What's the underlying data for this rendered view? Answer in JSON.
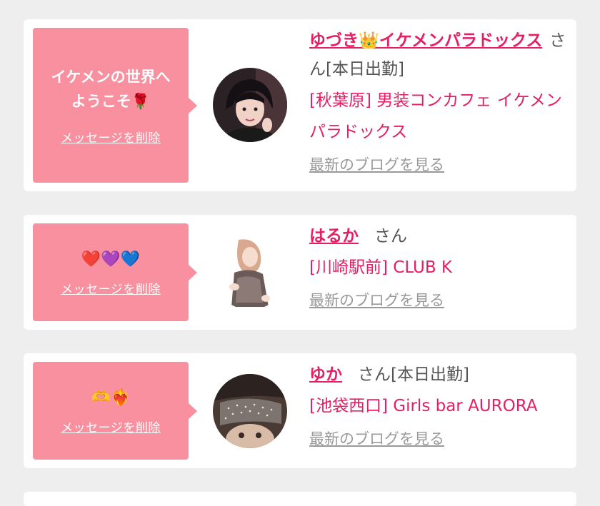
{
  "cards": [
    {
      "message": "イケメンの世界へ\nようこそ🌹",
      "delete_label": "メッセージを削除",
      "name": "ゆづき👑イケメンパラドックス",
      "san": "さん[本日出勤]",
      "shop": "[秋葉原] 男装コンカフェ イケメンパラドックス",
      "blog_label": "最新のブログを見る",
      "avatar": "person-photo"
    },
    {
      "message": "❤️💜💙",
      "delete_label": "メッセージを削除",
      "name": "はるか",
      "san": "さん",
      "shop": "[川崎駅前] CLUB K",
      "blog_label": "最新のブログを見る",
      "avatar": "person-photo"
    },
    {
      "message": "🫶❤️‍🔥",
      "delete_label": "メッセージを削除",
      "name": "ゆか",
      "san": "さん[本日出勤]",
      "shop": "[池袋西口] Girls bar AURORA",
      "blog_label": "最新のブログを見る",
      "avatar": "person-photo"
    }
  ],
  "colors": {
    "background": "#eeeeee",
    "card": "#ffffff",
    "bubble": "#f8909f",
    "accent": "#e61e64",
    "muted": "#999999"
  }
}
